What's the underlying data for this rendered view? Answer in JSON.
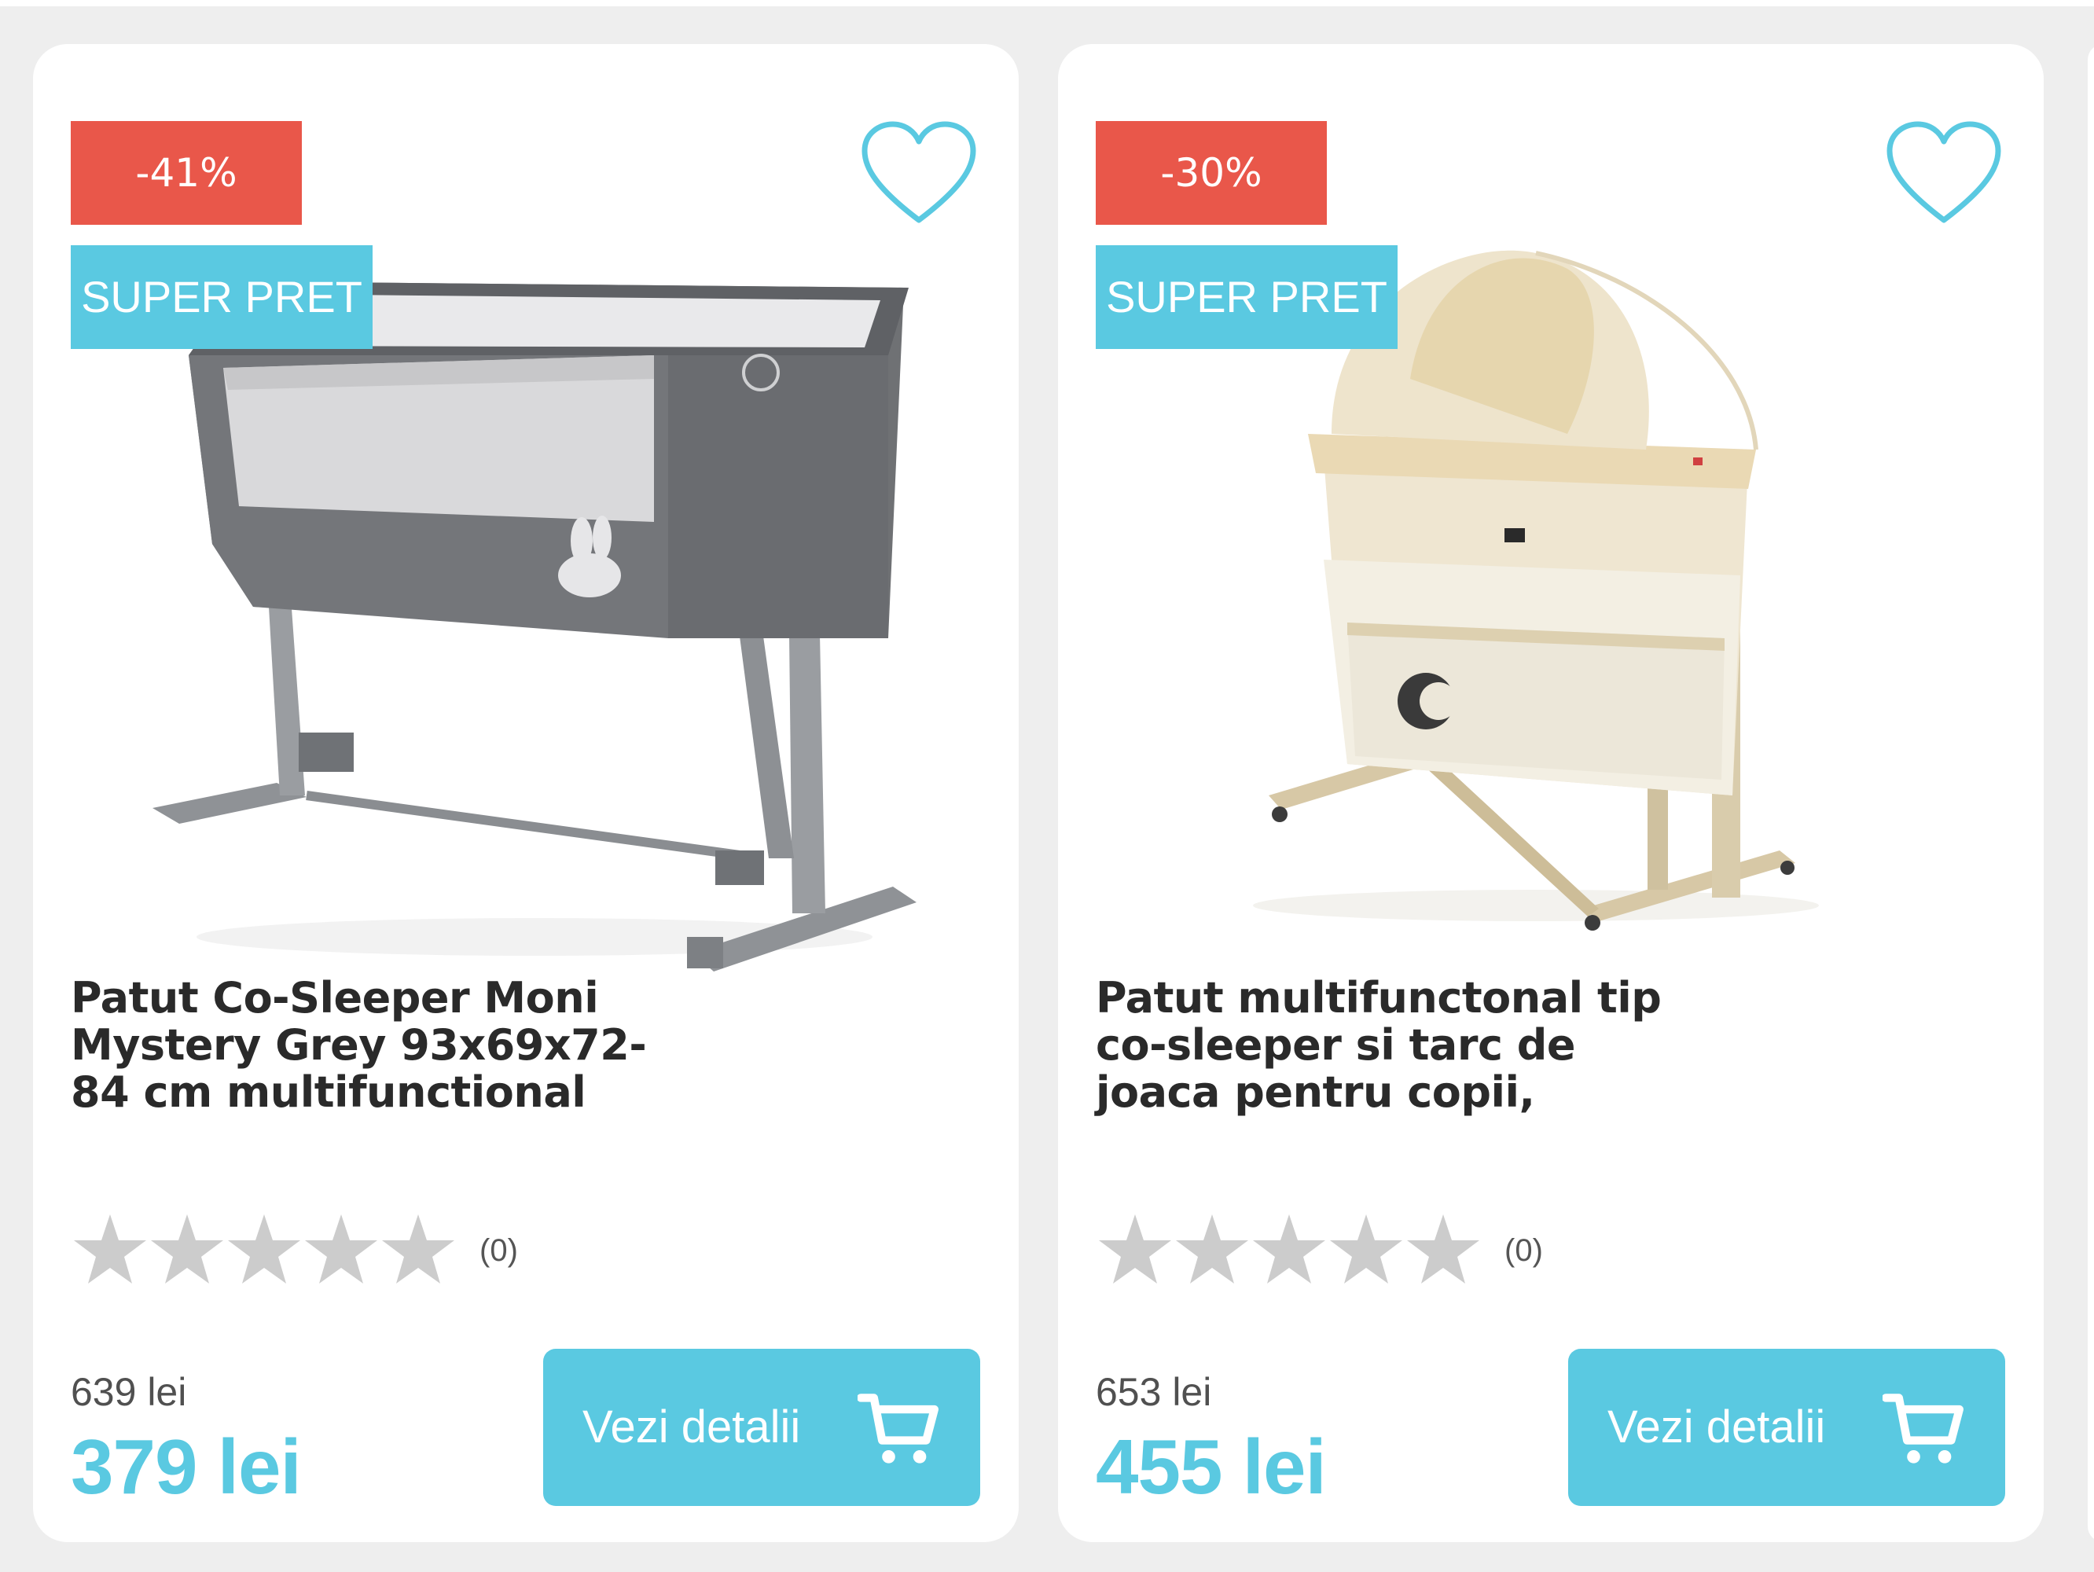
{
  "colors": {
    "page_background": "#eeeeee",
    "card_background": "#ffffff",
    "accent": "#5ac9e1",
    "discount_badge": "#e9574a",
    "star_empty": "#cccccc",
    "title_text": "#2a2a2a"
  },
  "products": [
    {
      "discount": "-41%",
      "promo_label": "SUPER PRET",
      "title_lines": [
        "Patut Co-Sleeper Moni",
        "Mystery Grey 93x69x72-",
        "84 cm multifunctional"
      ],
      "rating_stars": 0,
      "rating_count": "(0)",
      "old_price": "639 lei",
      "new_price": "379 lei",
      "button_label": "Vezi detalii",
      "image": "grey-co-sleeper-crib",
      "icons": [
        "heart-icon",
        "star-icon",
        "cart-icon"
      ]
    },
    {
      "discount": "-30%",
      "promo_label": "SUPER PRET",
      "title_lines": [
        "Patut multifunctonal tip",
        "co-sleeper si tarc de",
        "joaca pentru copii,"
      ],
      "rating_stars": 0,
      "rating_count": "(0)",
      "old_price": "653 lei",
      "new_price": "455 lei",
      "button_label": "Vezi detalii",
      "image": "beige-co-sleeper-crib-with-canopy",
      "icons": [
        "heart-icon",
        "star-icon",
        "cart-icon"
      ]
    }
  ]
}
